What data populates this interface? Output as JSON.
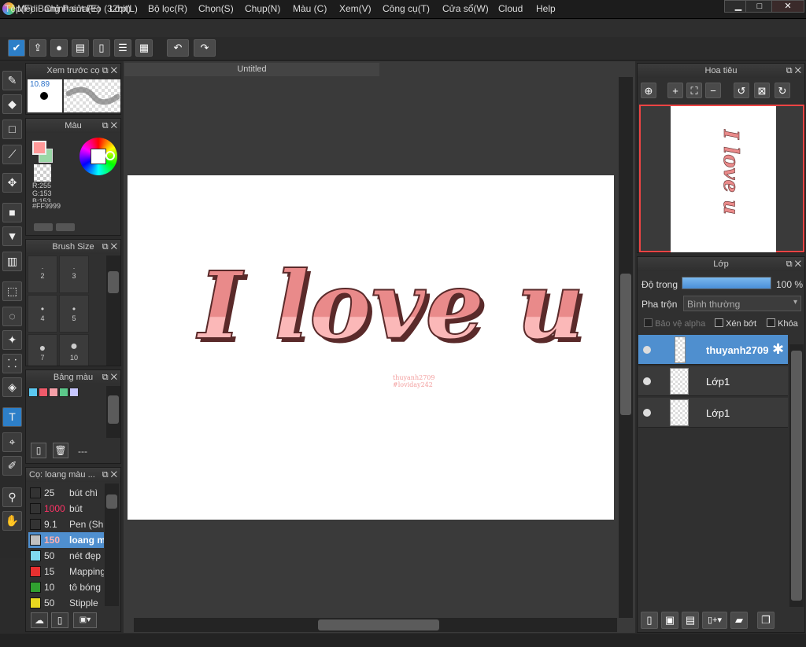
{
  "app": {
    "title": "MediBang Paint Pro (32bit)"
  },
  "window_controls": {
    "minimize": "▁",
    "maximize": "□",
    "close": "✕"
  },
  "menu": [
    "Tệp(F)",
    "Chỉnh sửa(E)",
    "Lớp(L)",
    "Bộ lọc(R)",
    "Chọn(S)",
    "Chụp(N)",
    "Màu (C)",
    "Xem(V)",
    "Công cụ(T)",
    "Cửa sổ(W)",
    "Cloud",
    "Help"
  ],
  "brush_preview": {
    "title": "Xem trước cọ",
    "size": "10.89"
  },
  "color_panel": {
    "title": "Màu",
    "r": "R:255",
    "g": "G:153",
    "b": "B:153",
    "hex": "#FF9999",
    "primary": "#ff9999",
    "secondary": "#9ad7a6"
  },
  "brush_size": {
    "title": "Brush Size",
    "sizes": [
      "",
      "",
      "2",
      "3",
      "4",
      "5",
      "7",
      "10"
    ]
  },
  "palette": {
    "title": "Bảng màu",
    "colors": [
      "#5bc8f0",
      "#f05a6a",
      "#f5a0a8",
      "#5cc88a",
      "#c8c8ff"
    ],
    "label": "---"
  },
  "brush_list": {
    "title": "Cọ: loang màu ...",
    "items": [
      {
        "color": "#333333",
        "size": "25",
        "name": "bút chì"
      },
      {
        "color": "#333333",
        "size": "1000",
        "name": "bút"
      },
      {
        "color": "#333333",
        "size": "9.1",
        "name": "Pen (Sh"
      },
      {
        "color": "#c0c0c0",
        "size": "150",
        "name": "loang m"
      },
      {
        "color": "#7fd8f0",
        "size": "50",
        "name": "nét đẹp"
      },
      {
        "color": "#e83030",
        "size": "15",
        "name": "Mapping"
      },
      {
        "color": "#30a030",
        "size": "10",
        "name": "tô bóng"
      },
      {
        "color": "#e8d820",
        "size": "50",
        "name": "Stipple"
      }
    ]
  },
  "document": {
    "tab": "Untitled",
    "artwork_text": "I love u",
    "signature_line1": "thuyanh2709",
    "signature_line2": "#loviday242"
  },
  "navigator": {
    "title": "Hoa tiêu"
  },
  "layers": {
    "title": "Lớp",
    "opacity_label": "Độ trong",
    "opacity_value": "100 %",
    "blend_label": "Pha trộn",
    "blend_value": "Bình thường",
    "protect_alpha": "Bảo vệ alpha",
    "clipping": "Xén bớt",
    "lock": "Khóa",
    "items": [
      {
        "name": "thuyanh2709",
        "selected": true
      },
      {
        "name": "Lớp1",
        "selected": false
      },
      {
        "name": "Lớp1",
        "selected": false
      }
    ]
  }
}
